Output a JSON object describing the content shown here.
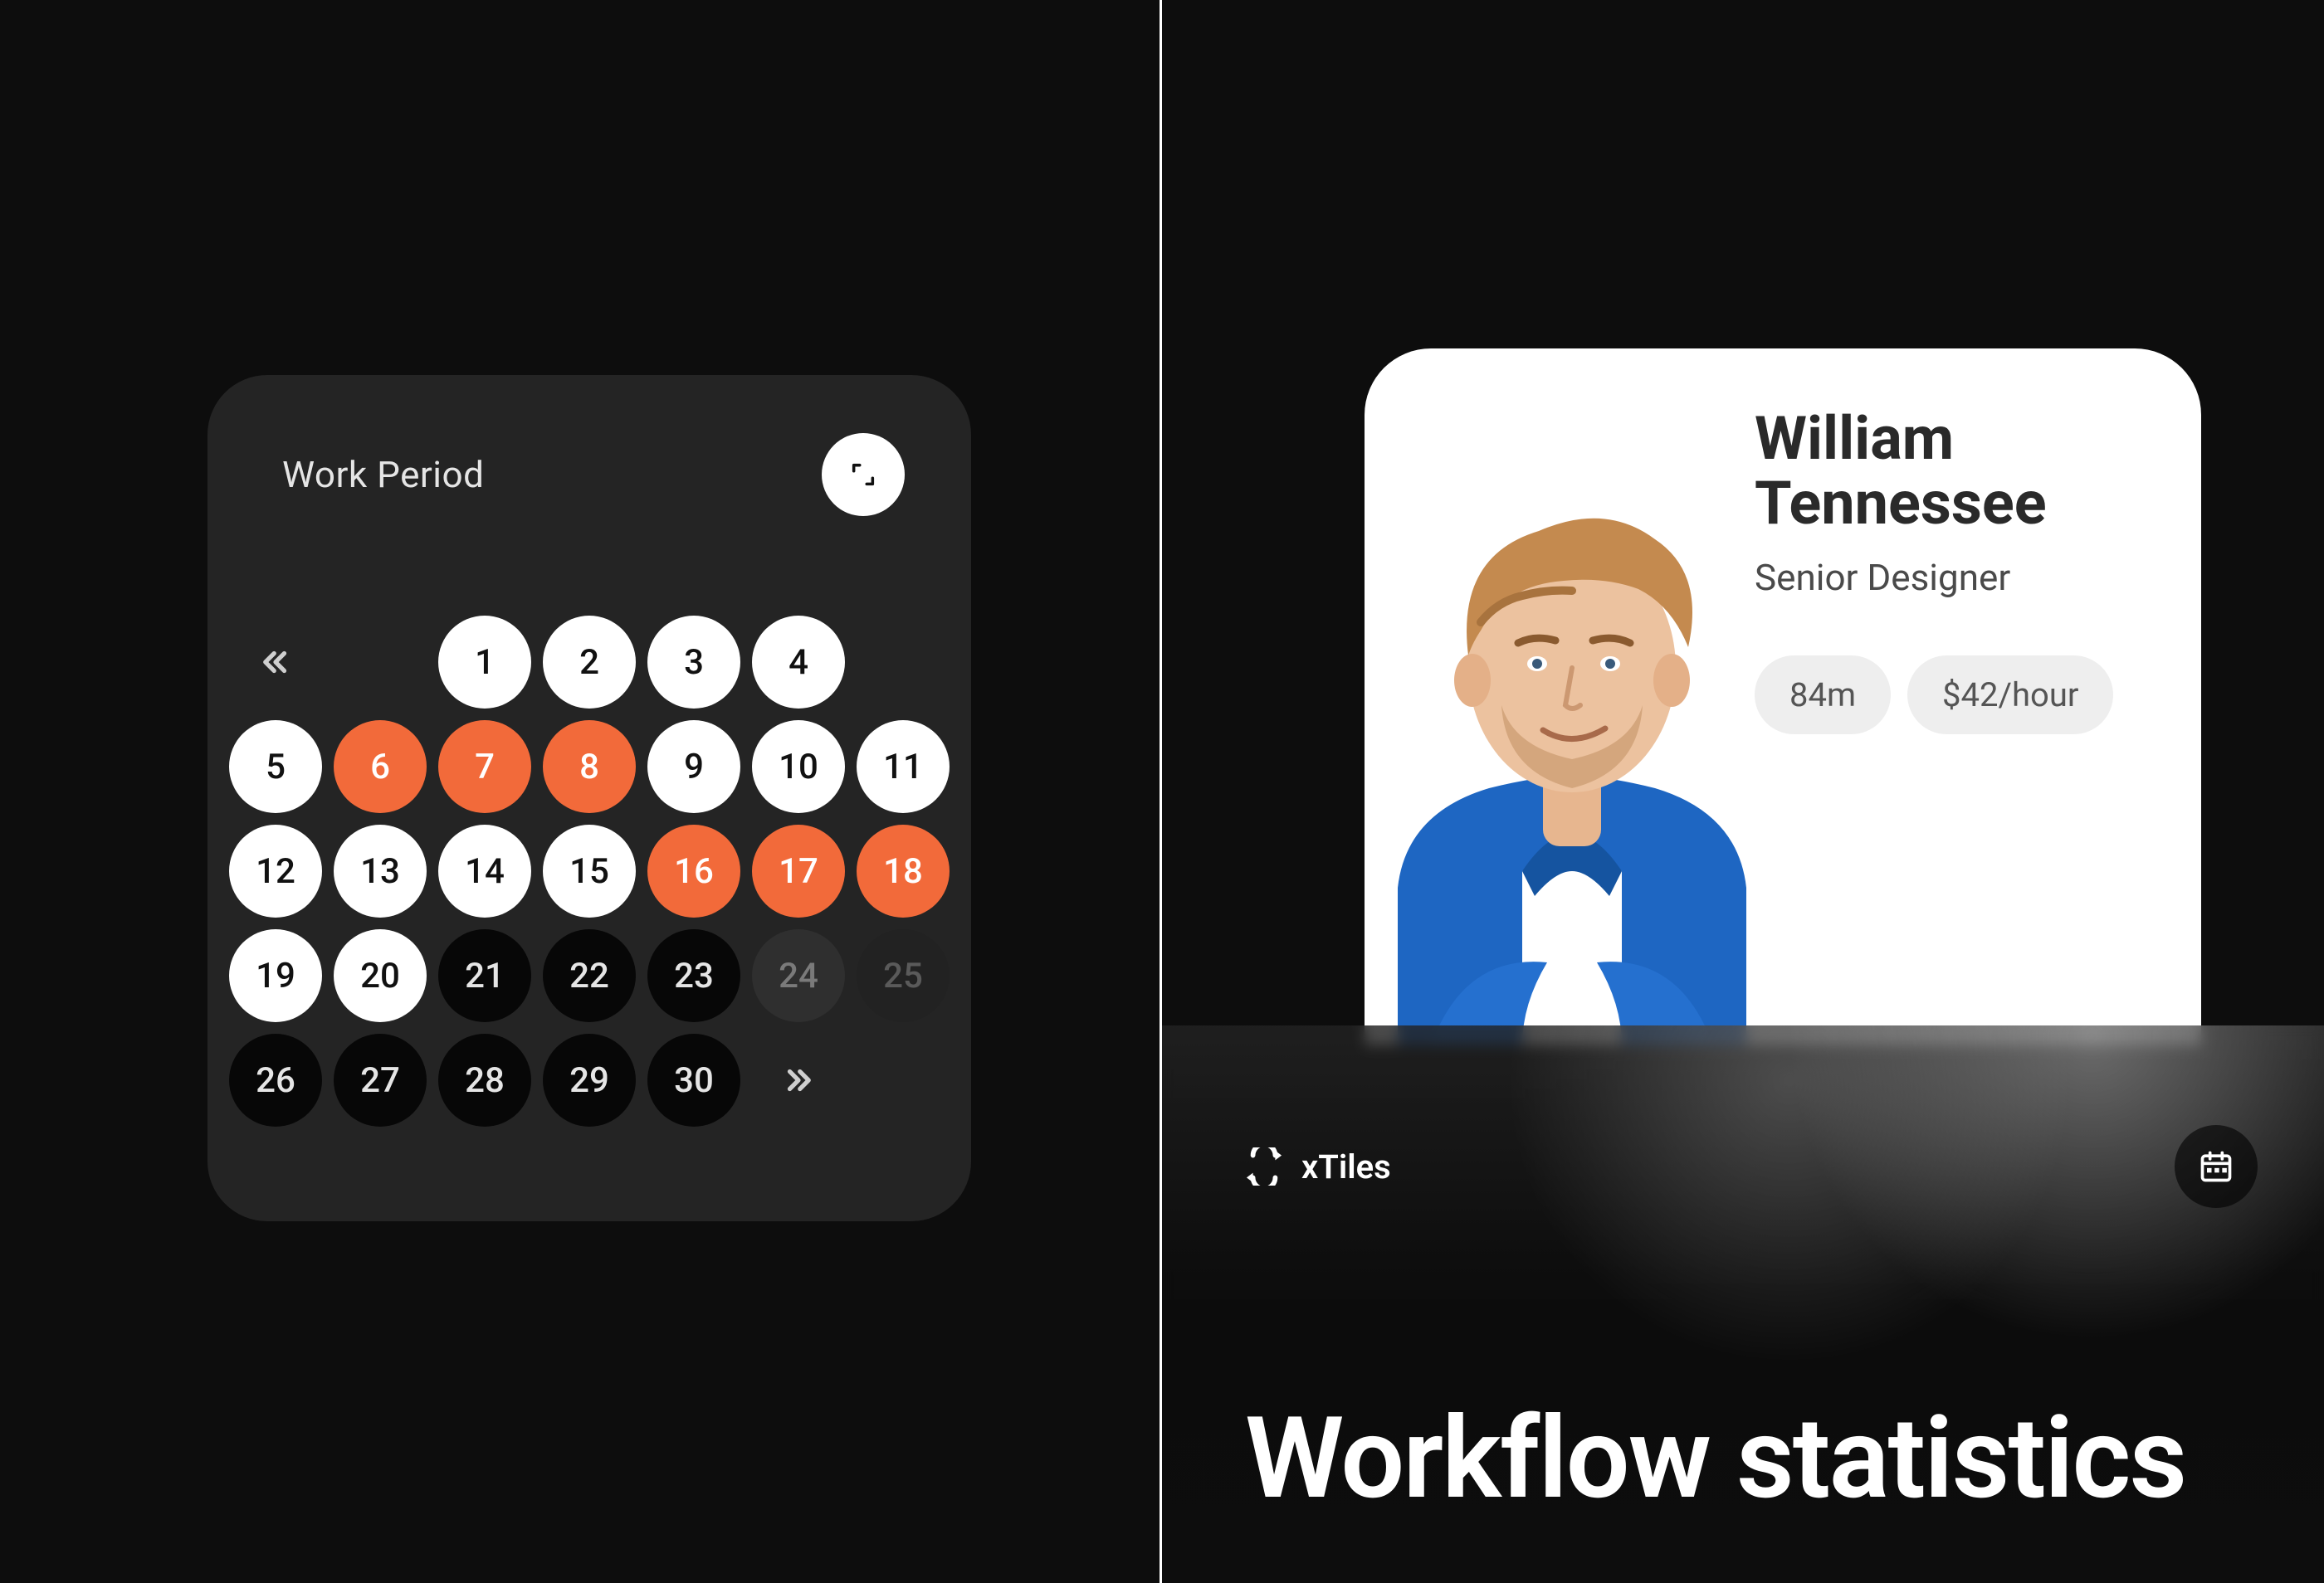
{
  "calendar": {
    "title": "Work Period",
    "expand_icon": "expand-icon",
    "prev_icon": "chevrons-left-icon",
    "next_icon": "chevrons-right-icon",
    "days": [
      {
        "label": "",
        "style": "nav-prev"
      },
      {
        "label": "",
        "style": "empty"
      },
      {
        "label": "1",
        "style": "white"
      },
      {
        "label": "2",
        "style": "white"
      },
      {
        "label": "3",
        "style": "white"
      },
      {
        "label": "4",
        "style": "white"
      },
      {
        "label": "",
        "style": "empty"
      },
      {
        "label": "5",
        "style": "white"
      },
      {
        "label": "6",
        "style": "orange"
      },
      {
        "label": "7",
        "style": "orange"
      },
      {
        "label": "8",
        "style": "orange"
      },
      {
        "label": "9",
        "style": "white"
      },
      {
        "label": "10",
        "style": "white"
      },
      {
        "label": "11",
        "style": "white"
      },
      {
        "label": "12",
        "style": "white"
      },
      {
        "label": "13",
        "style": "white"
      },
      {
        "label": "14",
        "style": "white"
      },
      {
        "label": "15",
        "style": "white"
      },
      {
        "label": "16",
        "style": "orange"
      },
      {
        "label": "17",
        "style": "orange"
      },
      {
        "label": "18",
        "style": "orange"
      },
      {
        "label": "19",
        "style": "white"
      },
      {
        "label": "20",
        "style": "white"
      },
      {
        "label": "21",
        "style": "black"
      },
      {
        "label": "22",
        "style": "black"
      },
      {
        "label": "23",
        "style": "black"
      },
      {
        "label": "24",
        "style": "dim"
      },
      {
        "label": "25",
        "style": "dim2"
      },
      {
        "label": "26",
        "style": "black"
      },
      {
        "label": "27",
        "style": "black"
      },
      {
        "label": "28",
        "style": "black"
      },
      {
        "label": "29",
        "style": "black"
      },
      {
        "label": "30",
        "style": "black"
      },
      {
        "label": "",
        "style": "nav-next"
      },
      {
        "label": "",
        "style": "empty"
      }
    ]
  },
  "profile": {
    "name_line1": "William",
    "name_line2": "Tennessee",
    "role": "Senior Designer",
    "chips": {
      "time": "84m",
      "rate": "$42/hour"
    }
  },
  "overlay": {
    "brand": "xTiles",
    "title": "Workflow statistics",
    "calendar_icon": "calendar-icon"
  },
  "colors": {
    "accent_orange": "#f26a3a",
    "card_bg": "#242424",
    "white": "#ffffff",
    "black": "#070707"
  }
}
